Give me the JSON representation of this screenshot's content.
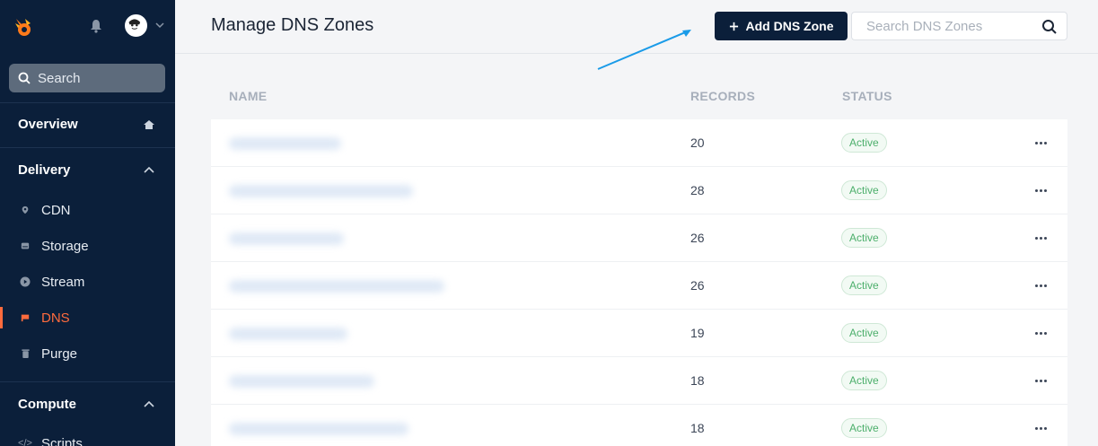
{
  "sidebar": {
    "search_label": "Search",
    "sections": {
      "overview": "Overview",
      "delivery": "Delivery",
      "compute": "Compute"
    },
    "items": [
      {
        "label": "CDN",
        "icon": "map-pin-icon",
        "active": false
      },
      {
        "label": "Storage",
        "icon": "storage-icon",
        "active": false
      },
      {
        "label": "Stream",
        "icon": "play-icon",
        "active": false
      },
      {
        "label": "DNS",
        "icon": "flag-icon",
        "active": true
      },
      {
        "label": "Purge",
        "icon": "trash-icon",
        "active": false
      }
    ],
    "compute_items": [
      {
        "label": "Scripts",
        "icon": "code-icon"
      }
    ]
  },
  "header": {
    "title": "Manage DNS Zones",
    "add_button_label": "Add DNS Zone",
    "search_placeholder": "Search DNS Zones"
  },
  "table": {
    "columns": [
      "NAME",
      "RECORDS",
      "STATUS"
    ],
    "rows": [
      {
        "records": "20",
        "status": "Active"
      },
      {
        "records": "28",
        "status": "Active"
      },
      {
        "records": "26",
        "status": "Active"
      },
      {
        "records": "26",
        "status": "Active"
      },
      {
        "records": "19",
        "status": "Active"
      },
      {
        "records": "18",
        "status": "Active"
      },
      {
        "records": "18",
        "status": "Active"
      }
    ]
  },
  "colors": {
    "sidebar_bg": "#0b1f3a",
    "accent": "#ff6b3d",
    "status_active": "#4caf6b",
    "annotation_arrow": "#1a9be8"
  }
}
